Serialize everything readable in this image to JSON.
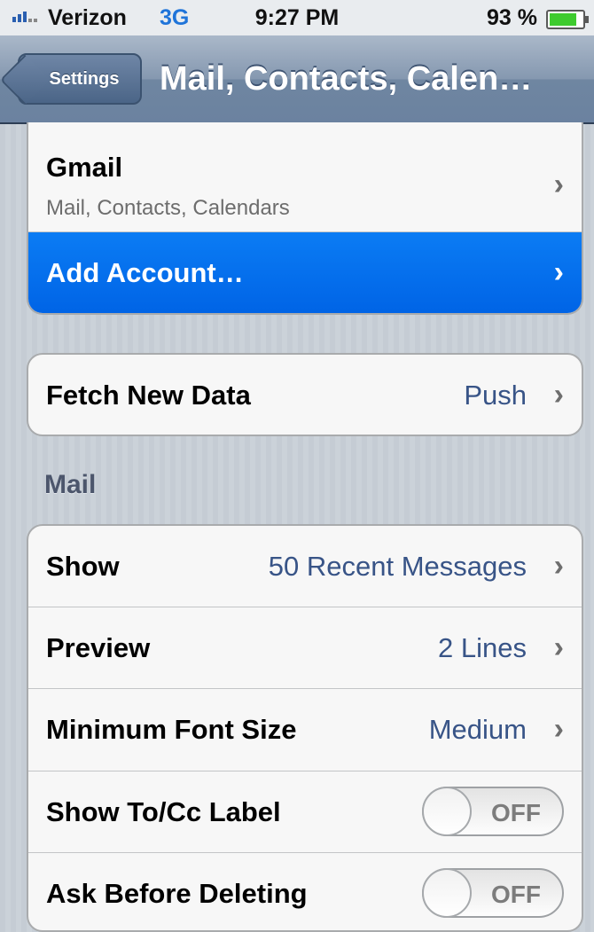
{
  "status_bar": {
    "carrier": "Verizon",
    "network": "3G",
    "time": "9:27 PM",
    "battery_percent": "93 %",
    "battery_level": 0.93
  },
  "nav": {
    "back_label": "Settings",
    "title": "Mail, Contacts, Calen…"
  },
  "accounts": {
    "gmail_title": "Gmail",
    "gmail_subtitle": "Mail, Contacts, Calendars",
    "add_account": "Add Account…"
  },
  "fetch": {
    "label": "Fetch New Data",
    "value": "Push"
  },
  "mail": {
    "header": "Mail",
    "show_label": "Show",
    "show_value": "50 Recent Messages",
    "preview_label": "Preview",
    "preview_value": "2 Lines",
    "font_label": "Minimum Font Size",
    "font_value": "Medium",
    "tocc_label": "Show To/Cc Label",
    "tocc_state": "OFF",
    "ask_label": "Ask Before Deleting",
    "ask_state": "OFF"
  },
  "colors": {
    "selected_row": "#0064e6",
    "value_text": "#385487"
  },
  "icons": {
    "chevron": "›"
  }
}
